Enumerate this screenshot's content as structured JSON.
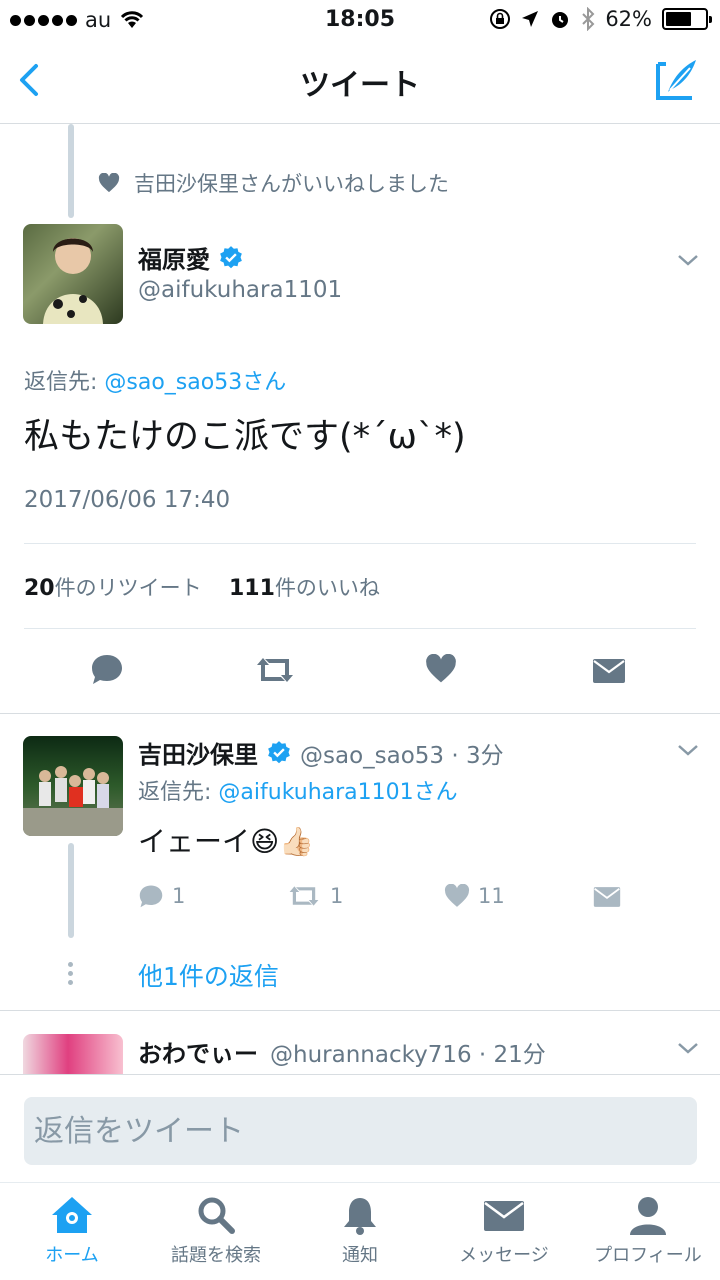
{
  "status_bar": {
    "carrier": "au",
    "time": "18:05",
    "battery": "62%"
  },
  "nav": {
    "title": "ツイート"
  },
  "liked_by": "吉田沙保里さんがいいねしました",
  "main_tweet": {
    "name": "福原愛",
    "handle": "@aifukuhara1101",
    "reply_prefix": "返信先: ",
    "reply_to": "@sao_sao53さん",
    "text": "私もたけのこ派です(*´ω`*)",
    "timestamp": "2017/06/06 17:40",
    "retweet_count": "20",
    "retweet_label": "件のリツイート",
    "like_count": "111",
    "like_label": "件のいいね"
  },
  "reply1": {
    "name": "吉田沙保里",
    "handle": "@sao_sao53 · 3分",
    "reply_prefix": "返信先: ",
    "reply_to": "@aifukuhara1101さん",
    "text": "イェーイ😆👍🏻",
    "reply_count": "1",
    "retweet_count": "1",
    "like_count": "11",
    "more_replies": "他1件の返信"
  },
  "reply2": {
    "name": "おわでぃー",
    "handle": "@hurannacky716 · 21分"
  },
  "reply_input": {
    "placeholder": "返信をツイート"
  },
  "tabs": [
    {
      "label": "ホーム",
      "icon": "home-icon"
    },
    {
      "label": "話題を検索",
      "icon": "search-icon"
    },
    {
      "label": "通知",
      "icon": "bell-icon"
    },
    {
      "label": "メッセージ",
      "icon": "mail-icon"
    },
    {
      "label": "プロフィール",
      "icon": "person-icon"
    }
  ],
  "colors": {
    "accent": "#1da1f2",
    "muted": "#657786",
    "icon": "#8899a6"
  }
}
